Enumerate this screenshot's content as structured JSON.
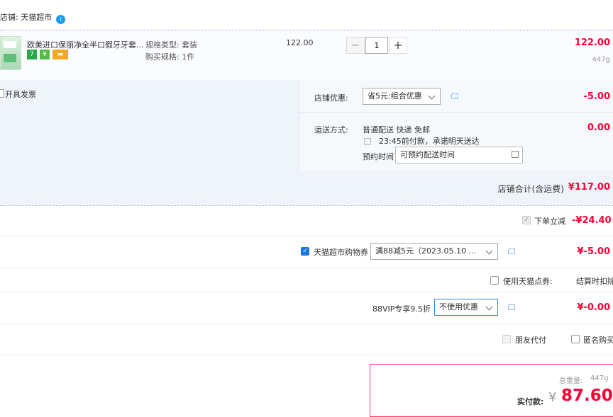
{
  "shop": {
    "label": "店铺: 天猫超市",
    "ww_badge": "i"
  },
  "item": {
    "title": "欧美进口保丽净全半口假牙牙套...",
    "badges": [
      {
        "text": "7",
        "color": "#27a844"
      },
      {
        "text": "¥",
        "color": "#54b948"
      },
      {
        "text": "▬",
        "color": "#f5a623"
      }
    ],
    "spec_type_label": "规格类型: 套装",
    "spec_buy_label": "购买规格: 1件",
    "unit_price": "122.00",
    "quantity": "1",
    "minus": "−",
    "plus": "+",
    "subtotal": "122.00",
    "weight": "447g"
  },
  "invoice": {
    "label": "开具发票"
  },
  "shop_discount": {
    "label": "店铺优惠:",
    "selected": "省5元:组合优惠",
    "amount": "-5.00"
  },
  "shipping": {
    "label": "运送方式:",
    "method": "普通配送 快递 免邮",
    "promise": "23:45前付款，承诺明天送达",
    "amount": "0.00",
    "appointment_label": "预约时间",
    "appointment_value": "可预约配送时间"
  },
  "shop_total": {
    "label": "店铺合计(含运费)",
    "amount": "¥117.00"
  },
  "instant_discount": {
    "label": "下单立减",
    "amount": "-¥24.40"
  },
  "coupon": {
    "label": "天猫超市购物券",
    "selected": "满88减5元（2023.05.10 ...",
    "amount": "¥-5.00"
  },
  "points": {
    "label": "使用天猫点券:",
    "note": "结算时扣除"
  },
  "vip": {
    "label": "88VIP专享9.5折",
    "selected": "不使用优惠",
    "amount": "¥-0.00"
  },
  "friend_pay": {
    "label": "朋友代付"
  },
  "anonymous": {
    "label": "匿名购买"
  },
  "summary": {
    "weight_label": "总重量:",
    "weight_value": "447g",
    "pay_label": "实付款:",
    "currency": "¥",
    "pay_amount": "87.60"
  }
}
